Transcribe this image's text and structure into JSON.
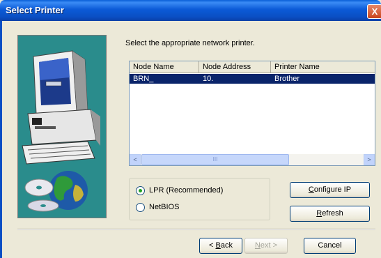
{
  "window": {
    "title": "Select Printer",
    "close_glyph": "X"
  },
  "prompt": "Select the appropriate network printer.",
  "printer_list": {
    "columns": [
      "Node Name",
      "Node Address",
      "Printer Name"
    ],
    "rows": [
      {
        "node_name": "BRN_",
        "node_address": "10.",
        "printer_name": "Brother",
        "selected": true
      }
    ]
  },
  "scrollbar": {
    "left_arrow": "<",
    "right_arrow": ">",
    "thumb_grip": "III"
  },
  "protocol": {
    "options": [
      {
        "label": "LPR (Recommended)",
        "checked": true
      },
      {
        "label": "NetBIOS",
        "checked": false
      }
    ]
  },
  "buttons": {
    "configure_ip": {
      "pre": "",
      "accel": "C",
      "post": "onfigure IP"
    },
    "refresh": {
      "pre": "",
      "accel": "R",
      "post": "efresh"
    },
    "back": {
      "pre": "< ",
      "accel": "B",
      "post": "ack"
    },
    "next": {
      "pre": "",
      "accel": "N",
      "post": "ext >",
      "disabled": true
    },
    "cancel": {
      "label": "Cancel"
    }
  },
  "colors": {
    "selection": "#0a246a",
    "titlebar": "#0a5fd8",
    "art_background": "#2a8c8c"
  }
}
